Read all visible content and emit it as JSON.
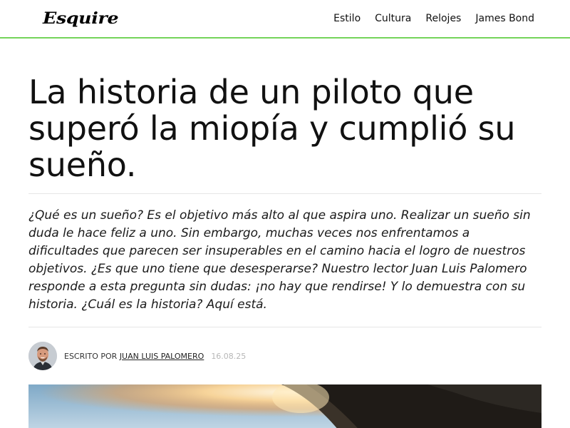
{
  "header": {
    "logo_text": "Esquire",
    "nav": [
      {
        "label": "Estilo"
      },
      {
        "label": "Cultura"
      },
      {
        "label": "Relojes"
      },
      {
        "label": "James Bond"
      }
    ],
    "accent_color": "#74d45a"
  },
  "article": {
    "title": "La historia de un piloto que superó la miopía y cumplió su sueño.",
    "lede": "¿Qué es un sueño? Es el objetivo más alto al que aspira uno. Realizar un sueño sin duda le hace feliz a uno. Sin embargo, muchas veces nos enfrentamos a dificultades que parecen ser insuperables en el camino hacia el logro de nuestros objetivos. ¿Es que uno tiene que desesperarse? Nuestro lector Juan Luis Palomero responde a esta pregunta sin dudas: ¡no hay que rendirse! Y lo demuestra con su historia. ¿Cuál es la historia? Aquí está.",
    "byline_prefix": "Escrito por",
    "author": "Juan Luis Palomero",
    "date": "16.08.25"
  }
}
